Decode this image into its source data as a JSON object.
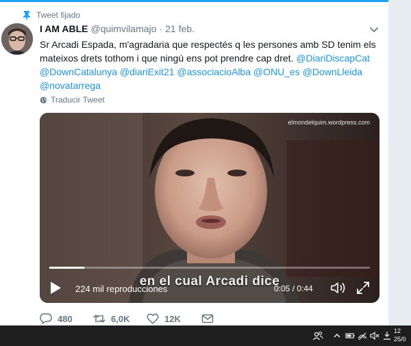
{
  "tweet": {
    "pinned_label": "Tweet fijado",
    "author_name": "I AM ABLE",
    "handle": "@quimvilamajo",
    "separator": "·",
    "date": "21 feb.",
    "text_plain": "Sr Arcadi Espada, m'agradaria que respectés q les persones amb SD tenim els mateixos drets tothom i que ningú ens pot prendre cap dret.",
    "mentions": [
      "@DiariDiscapCat",
      "@DownCatalunya",
      "@diariExit21",
      "@associacioAlba",
      "@ONU_es",
      "@DownLleida",
      "@novatarrega"
    ],
    "translate_label": "Traducir Tweet"
  },
  "video": {
    "watermark": "elmondelquim.wordpress.com",
    "subtitle": "en el cual Arcadi dice",
    "views": "224 mil reproducciones",
    "time": "0:05 / 0:44",
    "progress_fraction": 0.11
  },
  "actions": {
    "replies": "480",
    "retweets": "6,0K",
    "likes": "12K"
  },
  "taskbar": {
    "clock_time": "12",
    "clock_date": "25/0"
  },
  "icons": [
    "pin-icon",
    "caret-down-icon",
    "globe-icon",
    "play-icon",
    "volume-icon",
    "fullscreen-icon",
    "reply-icon",
    "retweet-icon",
    "like-icon",
    "dm-icon",
    "people-icon",
    "chevron-up-icon",
    "battery-icon",
    "wifi-icon",
    "speaker-muted-icon",
    "sync-icon"
  ],
  "colors": {
    "link": "#1b95e0",
    "accent": "#1da1f2",
    "muted": "#657786"
  }
}
